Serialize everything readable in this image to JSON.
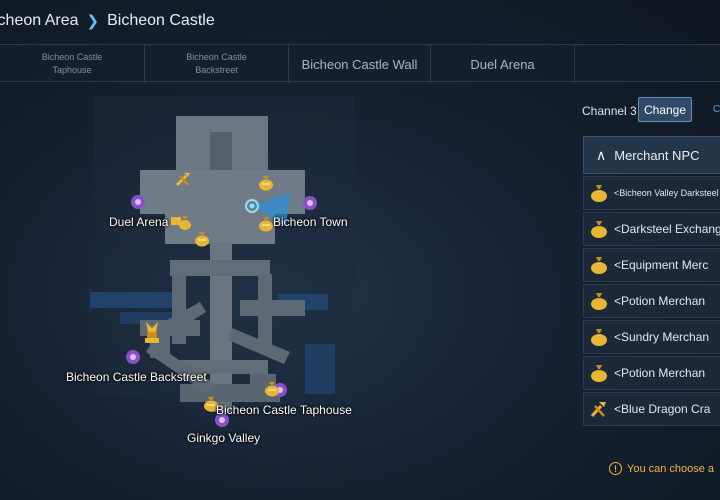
{
  "breadcrumb": {
    "area": "icheon Area",
    "current": "Bicheon Castle",
    "separator": "❯"
  },
  "tabs": [
    {
      "label_line1": "Bicheon Castle",
      "label_line2": "Taphouse"
    },
    {
      "label_line1": "Bicheon Castle",
      "label_line2": "Backstreet"
    },
    {
      "label": "Bicheon Castle Wall"
    },
    {
      "label": "Duel Arena"
    }
  ],
  "map": {
    "labels": {
      "duel_arena": "Duel Arena",
      "bicheon_town": "Bicheon Town",
      "backstreet": "Bicheon Castle Backstreet",
      "taphouse": "Bicheon Castle Taphouse",
      "ginkgo": "Ginkgo Valley"
    }
  },
  "side": {
    "channel_label": "Channel 3",
    "change_button": "Change",
    "clipped_text": "C",
    "section_title": "Merchant NPC",
    "npcs": [
      {
        "name": "<Bicheon Valley Darksteel",
        "icon": "money-bag-icon"
      },
      {
        "name": "<Darksteel Exchange",
        "icon": "money-bag-icon"
      },
      {
        "name": "<Equipment Merc",
        "icon": "money-bag-icon"
      },
      {
        "name": "<Potion Merchan",
        "icon": "money-bag-icon"
      },
      {
        "name": "<Sundry Merchan",
        "icon": "money-bag-icon"
      },
      {
        "name": "<Potion Merchan",
        "icon": "money-bag-icon"
      },
      {
        "name": "<Blue Dragon Cra",
        "icon": "crafting-tools-icon"
      }
    ],
    "notice": "You can choose a",
    "notice_icon": "!"
  },
  "colors": {
    "accent": "#5fc2ff",
    "warning": "#f0b540",
    "portal": "#8a4fc9",
    "gold": "#e9b633"
  }
}
